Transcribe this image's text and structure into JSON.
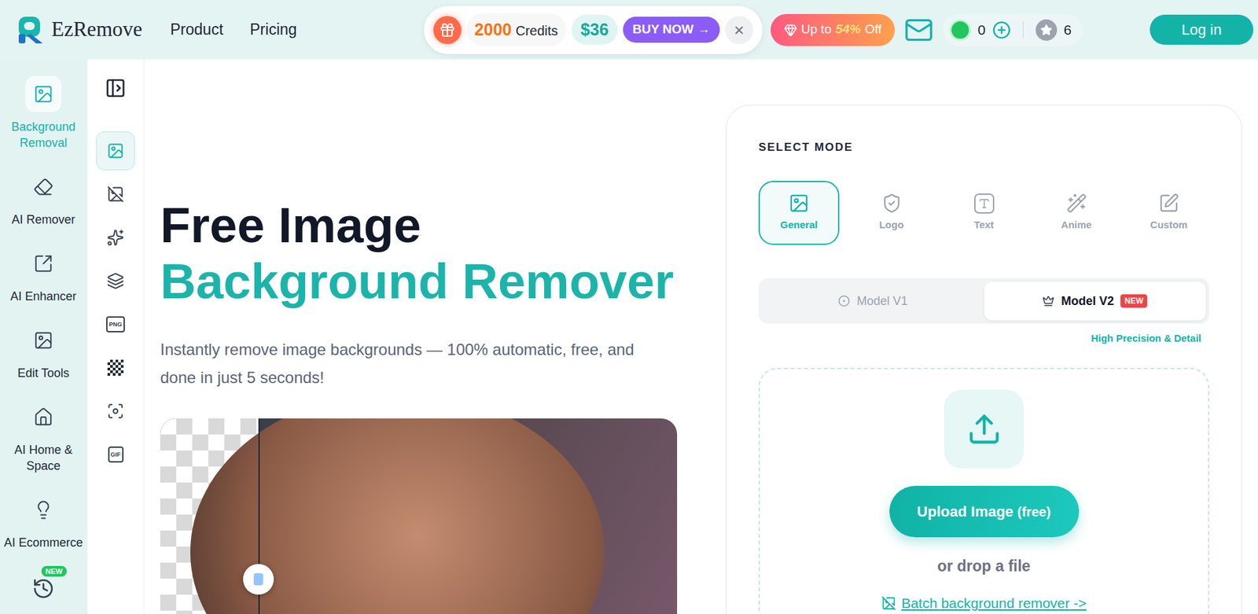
{
  "header": {
    "logo": "EzRemove",
    "nav": [
      "Product",
      "Pricing"
    ],
    "promo": {
      "credits": "2000",
      "credits_label": "Credits",
      "price": "$36",
      "buy": "BUY NOW",
      "buy_arrow": "→",
      "close": "×"
    },
    "discount": {
      "prefix": "Up to",
      "percent": "54%",
      "suffix": "Off"
    },
    "coins": "0",
    "stars": "6",
    "login": "Log in"
  },
  "sidebar": {
    "items": [
      {
        "label": "Background Removal",
        "selected": true
      },
      {
        "label": "AI Remover",
        "selected": false
      },
      {
        "label": "AI Enhancer",
        "selected": false
      },
      {
        "label": "Edit Tools",
        "selected": false
      },
      {
        "label": "AI Home & Space",
        "selected": false
      },
      {
        "label": "AI Ecommerce",
        "selected": false
      }
    ],
    "history_badge": "NEW"
  },
  "tools": {
    "items": [
      {
        "selected": true
      },
      {
        "selected": false
      },
      {
        "selected": false
      },
      {
        "selected": false
      },
      {
        "selected": false,
        "text": "PNG"
      },
      {
        "selected": false
      },
      {
        "selected": false
      },
      {
        "selected": false,
        "text": "GIF"
      }
    ]
  },
  "hero": {
    "title_line1": "Free Image",
    "title_line2": "Background Remover",
    "subtitle": "Instantly remove image backgrounds — 100% automatic, free, and done in just 5 seconds!",
    "comparison": {
      "level": 0.19
    }
  },
  "panel": {
    "select_mode_label": "SELECT MODE",
    "modes": [
      {
        "label": "General",
        "selected": true
      },
      {
        "label": "Logo",
        "selected": false
      },
      {
        "label": "Text",
        "selected": false
      },
      {
        "label": "Anime",
        "selected": false
      },
      {
        "label": "Custom",
        "selected": false
      }
    ],
    "models": [
      {
        "label": "Model V1",
        "selected": false,
        "badge": ""
      },
      {
        "label": "Model V2",
        "selected": true,
        "badge": "NEW"
      }
    ],
    "model_note": "High Precision & Detail",
    "upload": {
      "button": "Upload Image",
      "button_suffix": "(free)",
      "drop": "or drop a file",
      "batch": "Batch background remover ->"
    }
  }
}
